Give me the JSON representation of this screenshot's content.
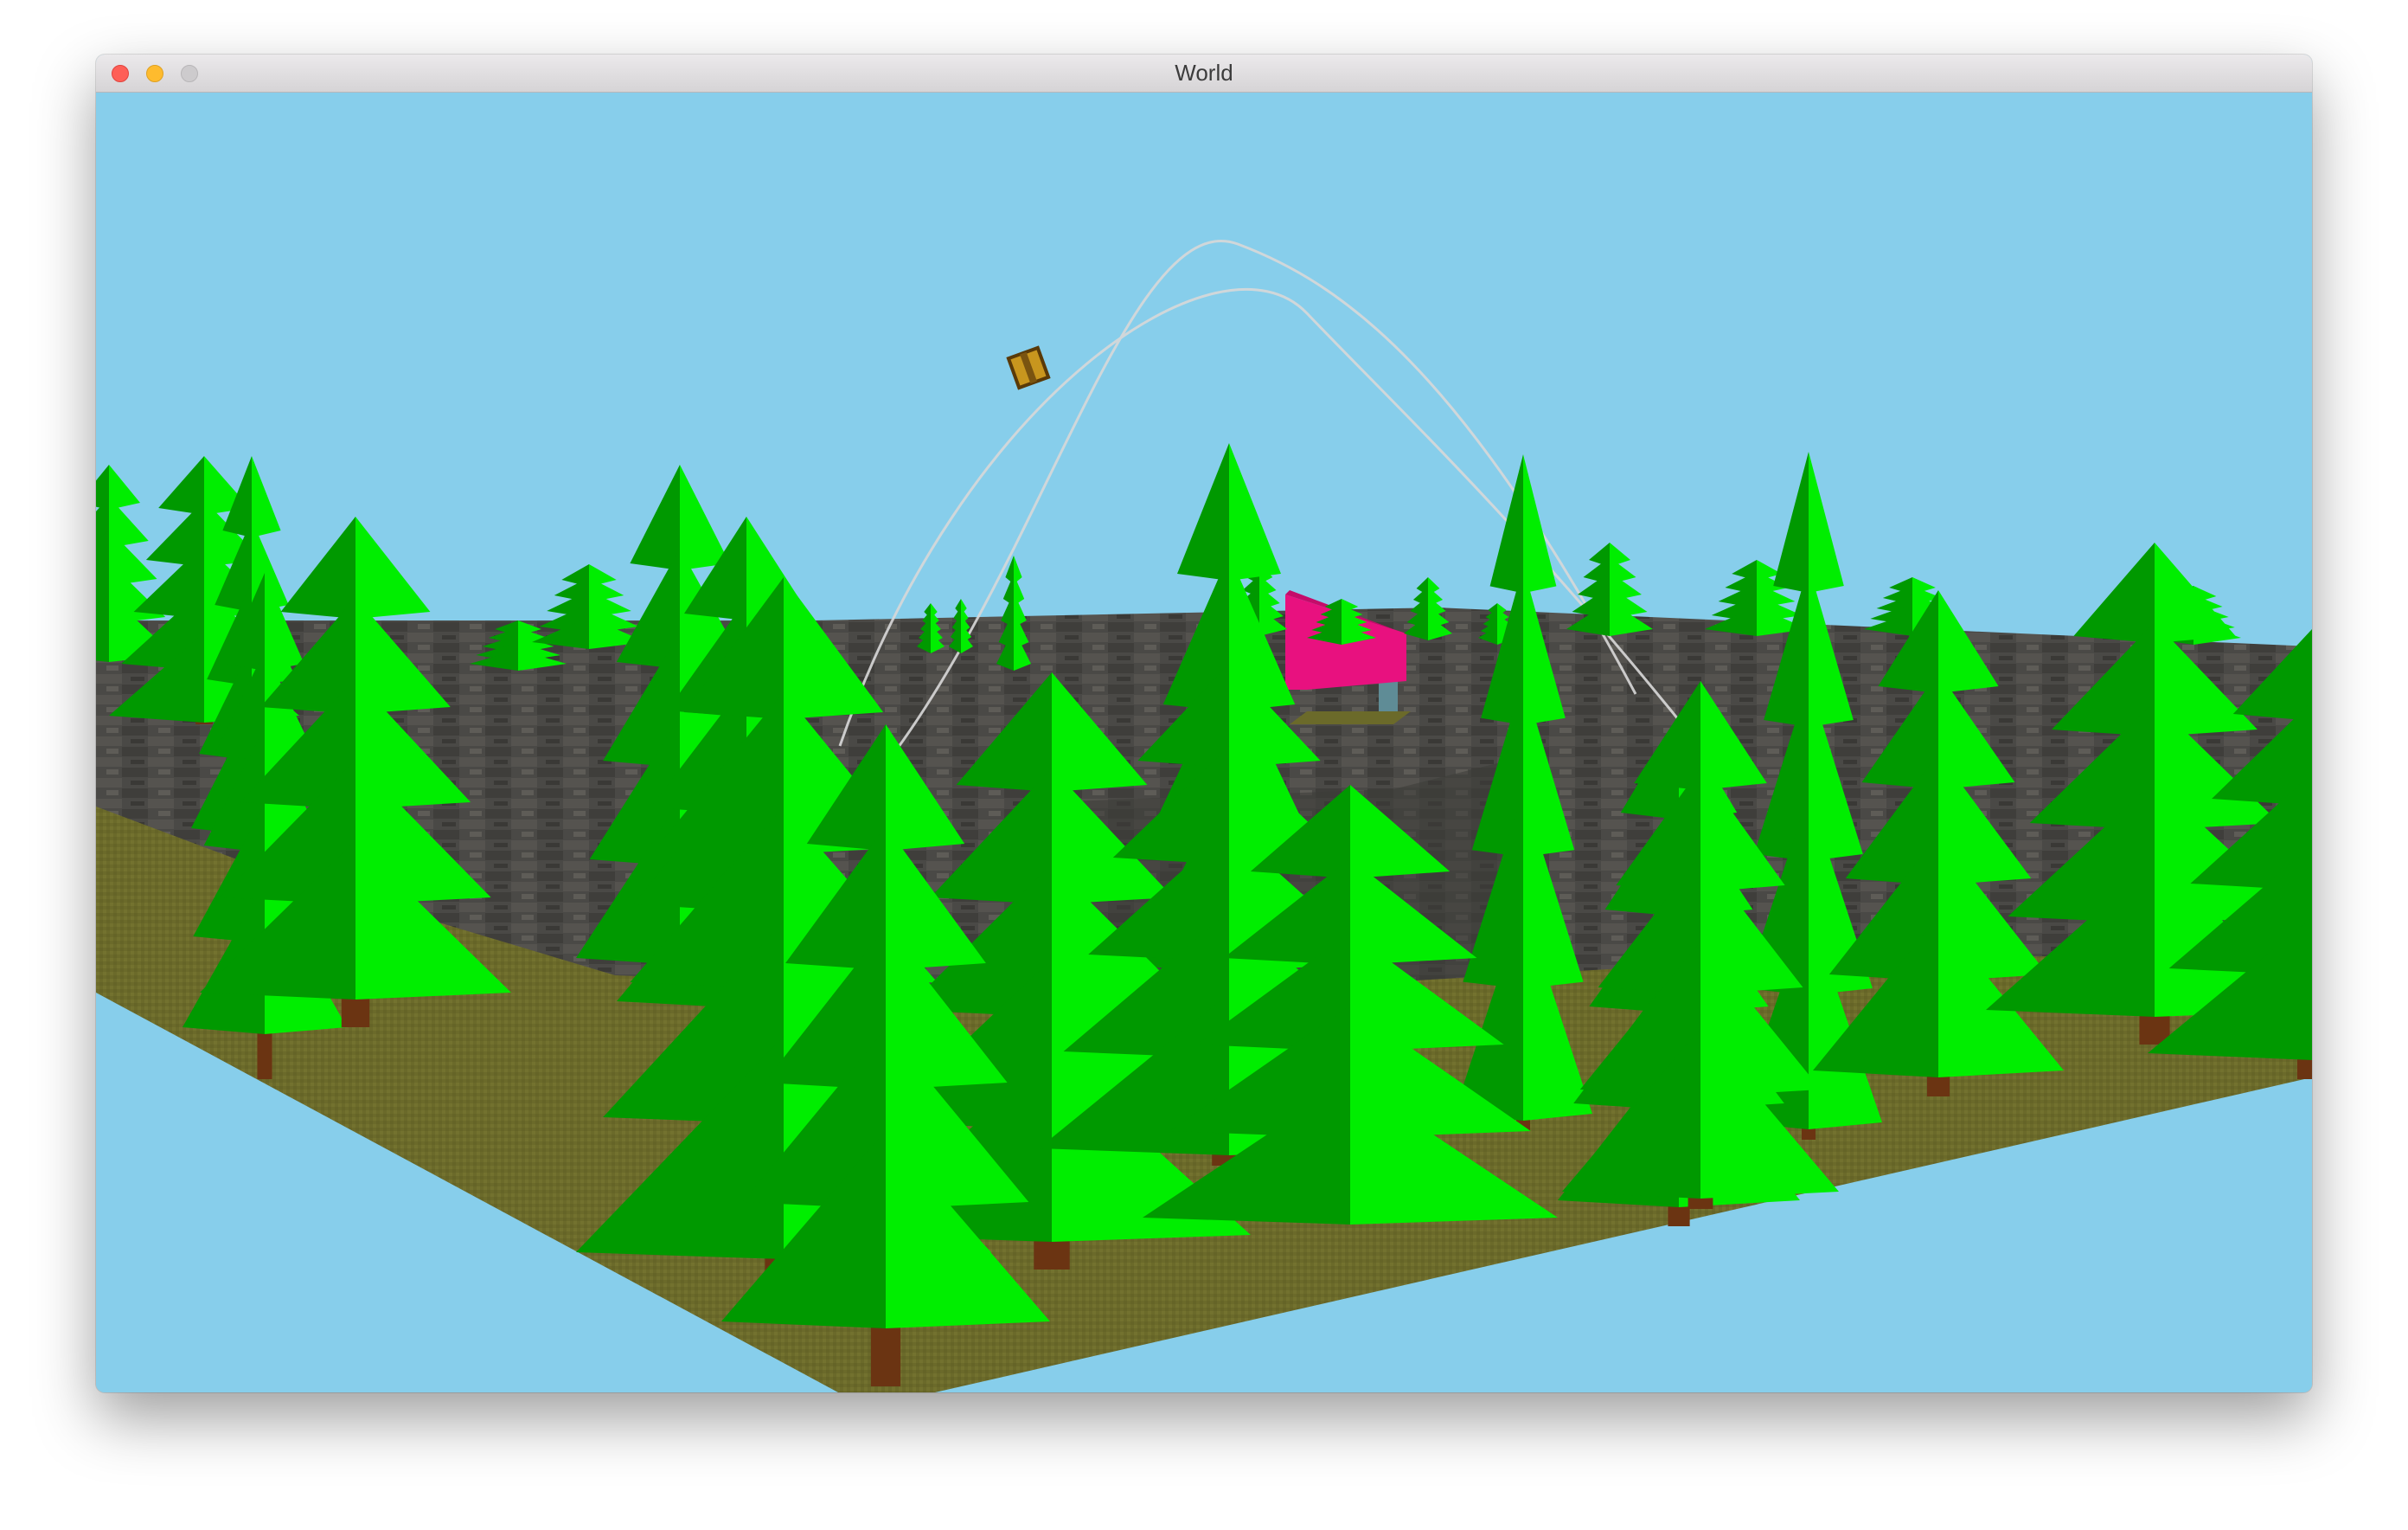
{
  "window": {
    "title": "World",
    "controls": [
      "close-button",
      "minimize-button",
      "zoom-button"
    ]
  },
  "scene": {
    "sky_color": "#87ceeb",
    "ground_color": "#6b6a2a",
    "tree_color": "#00ee00",
    "tree_shadow_color": "#009900",
    "trunk_color": "#6b3412",
    "rock_color": "#4a4946",
    "tent_color": "#e8117f",
    "tent_pole_color": "#5f8c96",
    "crate_color": "#c8961e",
    "trajectory_color": "#d9d9d9"
  }
}
